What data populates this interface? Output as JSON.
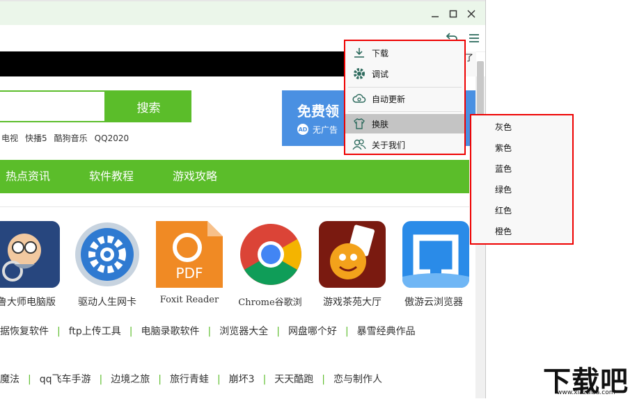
{
  "menu": {
    "items": [
      {
        "label": "下载",
        "icon": "download-icon"
      },
      {
        "label": "调试",
        "icon": "gear-icon"
      },
      {
        "label": "自动更新",
        "icon": "cloud-refresh-icon"
      },
      {
        "label": "换肤",
        "icon": "shirt-icon"
      },
      {
        "label": "关于我们",
        "icon": "users-icon"
      }
    ]
  },
  "skin_submenu": [
    "灰色",
    "紫色",
    "蓝色",
    "绿色",
    "红色",
    "橙色"
  ],
  "search": {
    "button_label": "搜索"
  },
  "hotwords": [
    "电视",
    "快播5",
    "酷狗音乐",
    "QQ2020"
  ],
  "ad": {
    "title": "免费领",
    "badge": "AD",
    "subtitle": "无广告"
  },
  "nav": [
    "热点资讯",
    "软件教程",
    "游戏攻略"
  ],
  "apps": [
    {
      "label": "鲁大师电脑版"
    },
    {
      "label": "驱动人生网卡"
    },
    {
      "label": "Foxit Reader",
      "icon_text": "PDF"
    },
    {
      "label": "Chrome谷歌浏"
    },
    {
      "label": "游戏茶苑大厅"
    },
    {
      "label": "傲游云浏览器"
    }
  ],
  "links_row1": [
    "据恢复软件",
    "ftp上传工具",
    "电脑录歌软件",
    "浏览器大全",
    "网盘哪个好",
    "暴雪经典作品"
  ],
  "links_row2": [
    "魔法",
    "qq飞车手游",
    "边境之旅",
    "旅行青蛙",
    "崩坏3",
    "天天酷跑",
    "恋与制作人"
  ],
  "blackbar_edge": "了",
  "watermark": {
    "text": "下载吧",
    "url": "www.xiazaiba.com"
  },
  "colors": {
    "accent": "#5bbd2a",
    "menu_border": "#e00000",
    "highlight": "#c4c4c4",
    "ad_blue": "#4a90e2"
  }
}
